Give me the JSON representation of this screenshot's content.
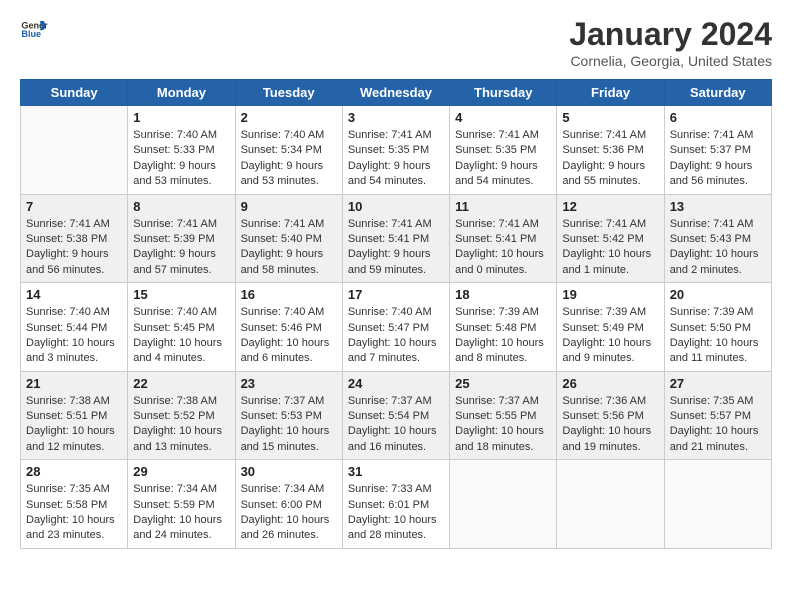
{
  "header": {
    "logo_general": "General",
    "logo_blue": "Blue",
    "title": "January 2024",
    "subtitle": "Cornelia, Georgia, United States"
  },
  "weekdays": [
    "Sunday",
    "Monday",
    "Tuesday",
    "Wednesday",
    "Thursday",
    "Friday",
    "Saturday"
  ],
  "weeks": [
    [
      {
        "day": "",
        "empty": true
      },
      {
        "day": "1",
        "sunrise": "7:40 AM",
        "sunset": "5:33 PM",
        "daylight": "9 hours and 53 minutes."
      },
      {
        "day": "2",
        "sunrise": "7:40 AM",
        "sunset": "5:34 PM",
        "daylight": "9 hours and 53 minutes."
      },
      {
        "day": "3",
        "sunrise": "7:41 AM",
        "sunset": "5:35 PM",
        "daylight": "9 hours and 54 minutes."
      },
      {
        "day": "4",
        "sunrise": "7:41 AM",
        "sunset": "5:35 PM",
        "daylight": "9 hours and 54 minutes."
      },
      {
        "day": "5",
        "sunrise": "7:41 AM",
        "sunset": "5:36 PM",
        "daylight": "9 hours and 55 minutes."
      },
      {
        "day": "6",
        "sunrise": "7:41 AM",
        "sunset": "5:37 PM",
        "daylight": "9 hours and 56 minutes."
      }
    ],
    [
      {
        "day": "7",
        "sunrise": "7:41 AM",
        "sunset": "5:38 PM",
        "daylight": "9 hours and 56 minutes."
      },
      {
        "day": "8",
        "sunrise": "7:41 AM",
        "sunset": "5:39 PM",
        "daylight": "9 hours and 57 minutes."
      },
      {
        "day": "9",
        "sunrise": "7:41 AM",
        "sunset": "5:40 PM",
        "daylight": "9 hours and 58 minutes."
      },
      {
        "day": "10",
        "sunrise": "7:41 AM",
        "sunset": "5:41 PM",
        "daylight": "9 hours and 59 minutes."
      },
      {
        "day": "11",
        "sunrise": "7:41 AM",
        "sunset": "5:41 PM",
        "daylight": "10 hours and 0 minutes."
      },
      {
        "day": "12",
        "sunrise": "7:41 AM",
        "sunset": "5:42 PM",
        "daylight": "10 hours and 1 minute."
      },
      {
        "day": "13",
        "sunrise": "7:41 AM",
        "sunset": "5:43 PM",
        "daylight": "10 hours and 2 minutes."
      }
    ],
    [
      {
        "day": "14",
        "sunrise": "7:40 AM",
        "sunset": "5:44 PM",
        "daylight": "10 hours and 3 minutes."
      },
      {
        "day": "15",
        "sunrise": "7:40 AM",
        "sunset": "5:45 PM",
        "daylight": "10 hours and 4 minutes."
      },
      {
        "day": "16",
        "sunrise": "7:40 AM",
        "sunset": "5:46 PM",
        "daylight": "10 hours and 6 minutes."
      },
      {
        "day": "17",
        "sunrise": "7:40 AM",
        "sunset": "5:47 PM",
        "daylight": "10 hours and 7 minutes."
      },
      {
        "day": "18",
        "sunrise": "7:39 AM",
        "sunset": "5:48 PM",
        "daylight": "10 hours and 8 minutes."
      },
      {
        "day": "19",
        "sunrise": "7:39 AM",
        "sunset": "5:49 PM",
        "daylight": "10 hours and 9 minutes."
      },
      {
        "day": "20",
        "sunrise": "7:39 AM",
        "sunset": "5:50 PM",
        "daylight": "10 hours and 11 minutes."
      }
    ],
    [
      {
        "day": "21",
        "sunrise": "7:38 AM",
        "sunset": "5:51 PM",
        "daylight": "10 hours and 12 minutes."
      },
      {
        "day": "22",
        "sunrise": "7:38 AM",
        "sunset": "5:52 PM",
        "daylight": "10 hours and 13 minutes."
      },
      {
        "day": "23",
        "sunrise": "7:37 AM",
        "sunset": "5:53 PM",
        "daylight": "10 hours and 15 minutes."
      },
      {
        "day": "24",
        "sunrise": "7:37 AM",
        "sunset": "5:54 PM",
        "daylight": "10 hours and 16 minutes."
      },
      {
        "day": "25",
        "sunrise": "7:37 AM",
        "sunset": "5:55 PM",
        "daylight": "10 hours and 18 minutes."
      },
      {
        "day": "26",
        "sunrise": "7:36 AM",
        "sunset": "5:56 PM",
        "daylight": "10 hours and 19 minutes."
      },
      {
        "day": "27",
        "sunrise": "7:35 AM",
        "sunset": "5:57 PM",
        "daylight": "10 hours and 21 minutes."
      }
    ],
    [
      {
        "day": "28",
        "sunrise": "7:35 AM",
        "sunset": "5:58 PM",
        "daylight": "10 hours and 23 minutes."
      },
      {
        "day": "29",
        "sunrise": "7:34 AM",
        "sunset": "5:59 PM",
        "daylight": "10 hours and 24 minutes."
      },
      {
        "day": "30",
        "sunrise": "7:34 AM",
        "sunset": "6:00 PM",
        "daylight": "10 hours and 26 minutes."
      },
      {
        "day": "31",
        "sunrise": "7:33 AM",
        "sunset": "6:01 PM",
        "daylight": "10 hours and 28 minutes."
      },
      {
        "day": "",
        "empty": true
      },
      {
        "day": "",
        "empty": true
      },
      {
        "day": "",
        "empty": true
      }
    ]
  ],
  "labels": {
    "sunrise_prefix": "Sunrise: ",
    "sunset_prefix": "Sunset: ",
    "daylight_prefix": "Daylight: "
  }
}
